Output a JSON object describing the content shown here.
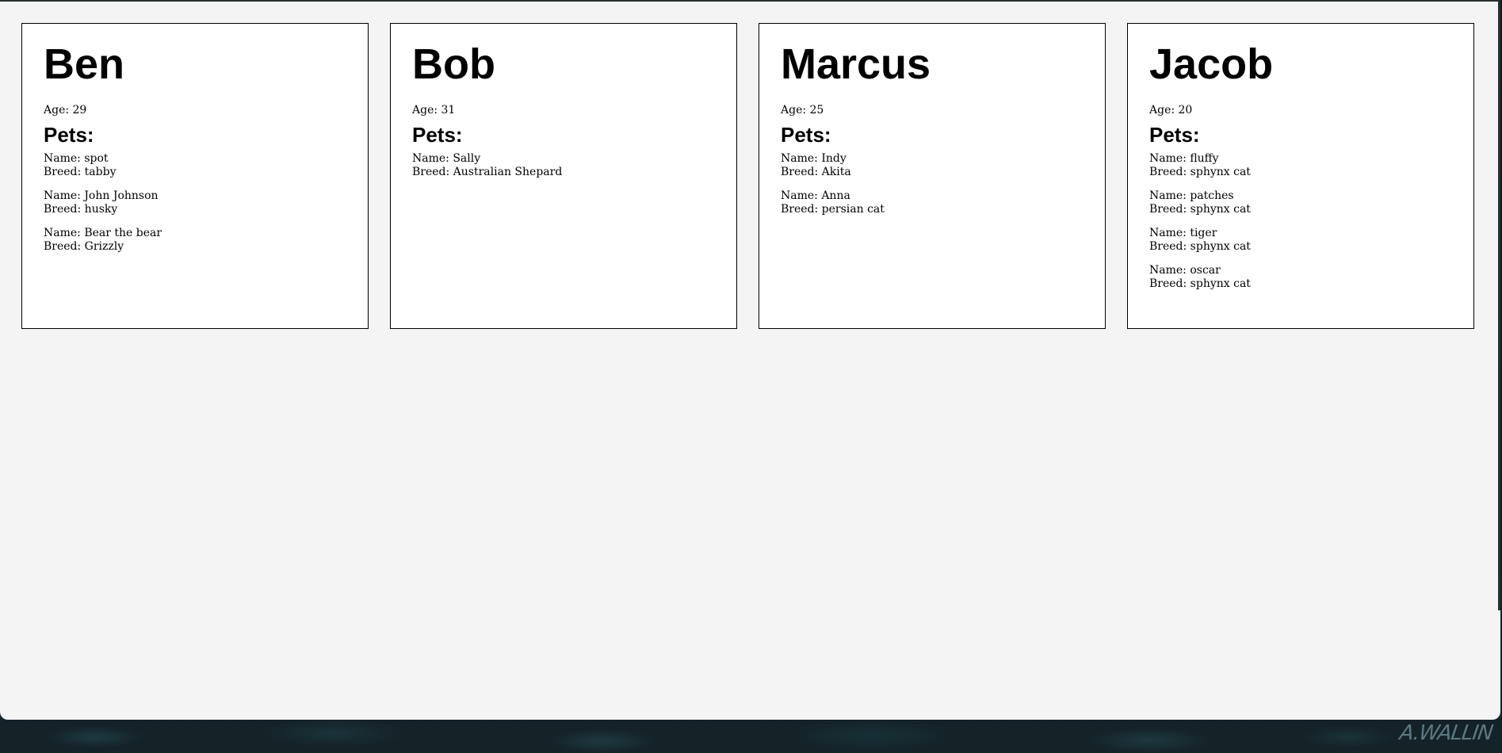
{
  "people": [
    {
      "name": "Ben",
      "age_label": "Age: 29",
      "pets_heading": "Pets:",
      "pets": [
        {
          "name": "Name: spot",
          "breed": "Breed: tabby"
        },
        {
          "name": "Name: John Johnson",
          "breed": "Breed: husky"
        },
        {
          "name": "Name: Bear the bear",
          "breed": "Breed: Grizzly"
        }
      ]
    },
    {
      "name": "Bob",
      "age_label": "Age: 31",
      "pets_heading": "Pets:",
      "pets": [
        {
          "name": "Name: Sally",
          "breed": "Breed: Australian Shepard"
        }
      ]
    },
    {
      "name": "Marcus",
      "age_label": "Age: 25",
      "pets_heading": "Pets:",
      "pets": [
        {
          "name": "Name: Indy",
          "breed": "Breed: Akita"
        },
        {
          "name": "Name: Anna",
          "breed": "Breed: persian cat"
        }
      ]
    },
    {
      "name": "Jacob",
      "age_label": "Age: 20",
      "pets_heading": "Pets:",
      "pets": [
        {
          "name": "Name: fluffy",
          "breed": "Breed: sphynx cat"
        },
        {
          "name": "Name: patches",
          "breed": "Breed: sphynx cat"
        },
        {
          "name": "Name: tiger",
          "breed": "Breed: sphynx cat"
        },
        {
          "name": "Name: oscar",
          "breed": "Breed: sphynx cat"
        }
      ]
    }
  ],
  "desktop": {
    "signature": "A.WALLIN"
  },
  "colors": {
    "page_background": "#f4f4f4",
    "card_background": "#ffffff",
    "card_border": "#000000",
    "desktop_background": "#101c22"
  }
}
